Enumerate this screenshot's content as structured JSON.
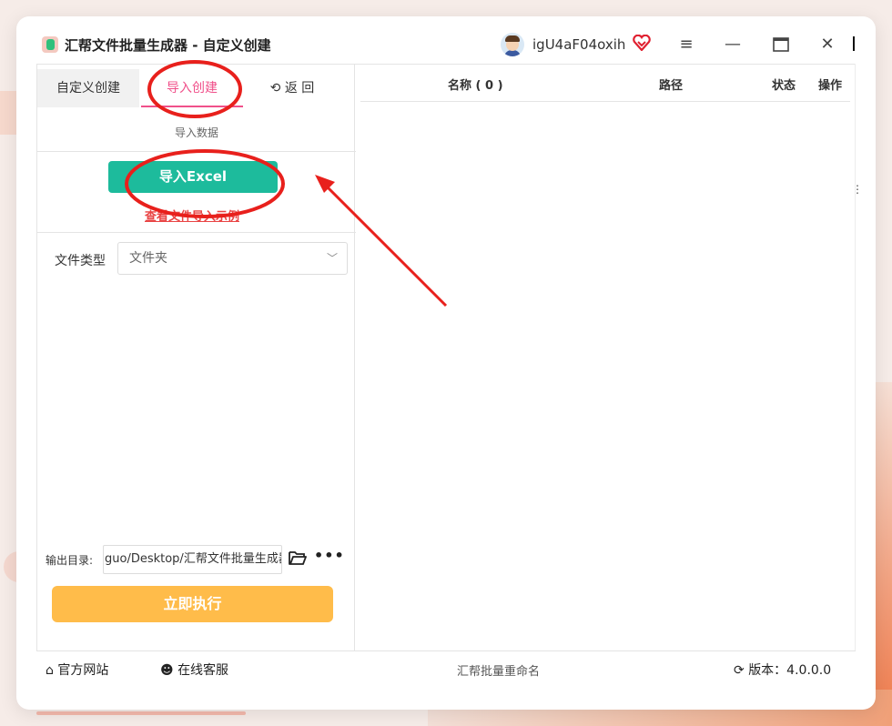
{
  "window": {
    "title": "汇帮文件批量生成器 - 自定义创建",
    "username": "igU4aF04oxih"
  },
  "left": {
    "tabs": [
      {
        "label": "自定义创建"
      },
      {
        "label": "导入创建"
      },
      {
        "label": "返 回"
      }
    ],
    "subtitle": "导入数据",
    "import_button": "导入Excel",
    "example_link": "查看文件导入示例",
    "file_type_label": "文件类型",
    "file_type_value": "文件夹",
    "output_label": "输出目录:",
    "output_value": "guo/Desktop/汇帮文件批量生成器",
    "run_button": "立即执行"
  },
  "right": {
    "columns": [
      "名称 ( 0 )",
      "路径",
      "状态",
      "操作"
    ]
  },
  "footer": {
    "website": "官方网站",
    "support": "在线客服",
    "center_text": "汇帮批量重命名",
    "version": "版本：4.0.0.0"
  },
  "colors": {
    "accent_pink": "#f0508a",
    "import_green": "#1dbb9c",
    "run_orange": "#ffbc4a",
    "annotation_red": "#e8201c"
  }
}
